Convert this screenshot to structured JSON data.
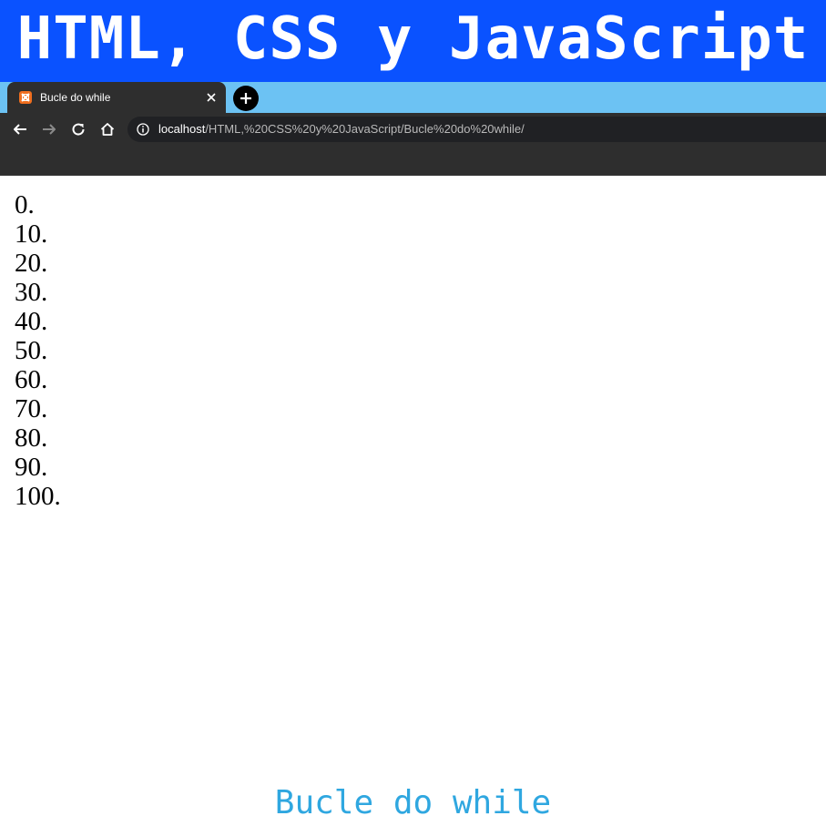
{
  "banner": {
    "title": "HTML, CSS y JavaScript"
  },
  "browser": {
    "tab": {
      "title": "Bucle do while",
      "favicon": "xampp-icon"
    },
    "address_bar": {
      "host": "localhost",
      "path": "/HTML,%20CSS%20y%20JavaScript/Bucle%20do%20while/"
    }
  },
  "page": {
    "lines": [
      "0.",
      "10.",
      "20.",
      "30.",
      "40.",
      "50.",
      "60.",
      "70.",
      "80.",
      "90.",
      "100."
    ]
  },
  "caption": {
    "text": "Bucle do while"
  },
  "colors": {
    "banner_bg": "#0a52ff",
    "tabstrip_bg": "#6cc2f3",
    "toolbar_bg": "#2e2e2e",
    "caption": "#2fa7e0"
  }
}
